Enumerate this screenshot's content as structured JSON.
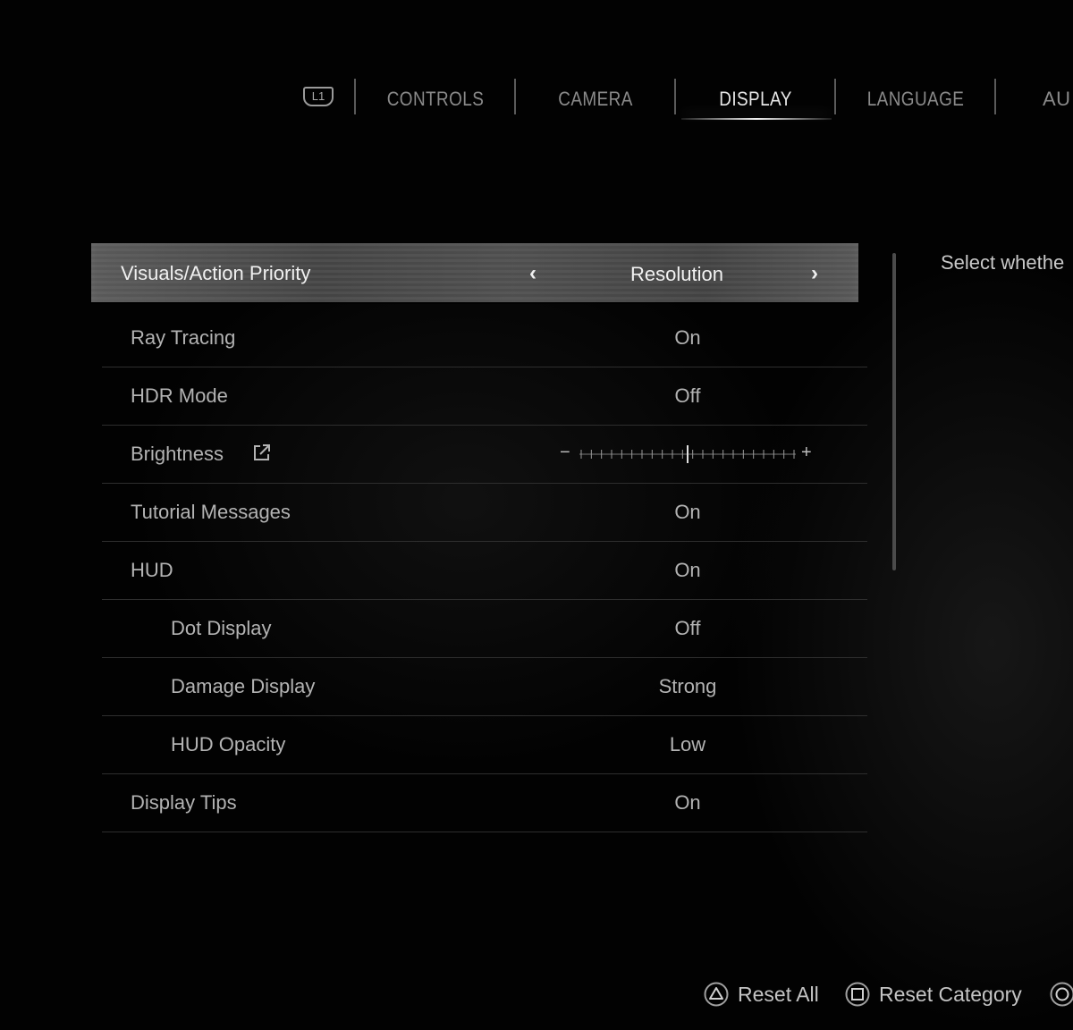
{
  "tabs": {
    "shoulder_button": "L1",
    "items": [
      {
        "label": "CONTROLS",
        "active": false
      },
      {
        "label": "CAMERA",
        "active": false
      },
      {
        "label": "DISPLAY",
        "active": true
      },
      {
        "label": "LANGUAGE",
        "active": false
      },
      {
        "label": "AU",
        "active": false
      }
    ]
  },
  "settings": [
    {
      "label": "Visuals/Action Priority",
      "value": "Resolution",
      "selected": true
    },
    {
      "label": "Ray Tracing",
      "value": "On"
    },
    {
      "label": "HDR Mode",
      "value": "Off"
    },
    {
      "label": "Brightness",
      "value": "",
      "control": "slider",
      "icon": "external-link-icon",
      "slider_level": 0.5,
      "slider_min_symbol": "−",
      "slider_max_symbol": "+"
    },
    {
      "label": "Tutorial Messages",
      "value": "On"
    },
    {
      "label": "HUD",
      "value": "On"
    },
    {
      "label": "Dot Display",
      "value": "Off",
      "indent": true
    },
    {
      "label": "Damage Display",
      "value": "Strong",
      "indent": true
    },
    {
      "label": "HUD Opacity",
      "value": "Low",
      "indent": true
    },
    {
      "label": "Display Tips",
      "value": "On"
    }
  ],
  "description": "Select whethe",
  "hints": [
    {
      "icon": "triangle-button-icon",
      "label": "Reset All"
    },
    {
      "icon": "square-button-icon",
      "label": "Reset Category"
    },
    {
      "icon": "circle-button-icon",
      "label": ""
    }
  ],
  "colors": {
    "background": "#020202",
    "text_primary": "#f0f0f0",
    "text_secondary": "#b3b3b3",
    "divider": "#2e2e2e"
  }
}
